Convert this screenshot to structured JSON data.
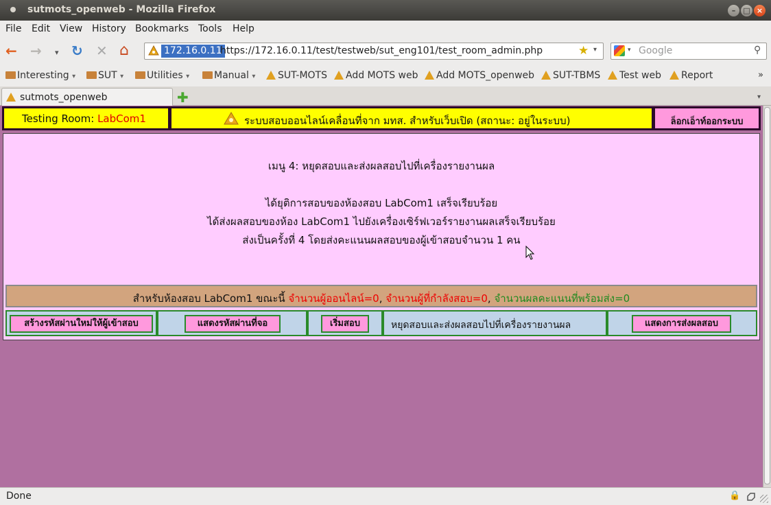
{
  "window": {
    "title": "sutmots_openweb - Mozilla Firefox",
    "min_glyph": "–",
    "max_glyph": "□",
    "close_glyph": "×"
  },
  "menu": [
    "File",
    "Edit",
    "View",
    "History",
    "Bookmarks",
    "Tools",
    "Help"
  ],
  "nav": {
    "back_icon": "←",
    "forward_icon": "→",
    "history_dropdown": "▾",
    "reload_icon": "↻",
    "stop_icon": "✕",
    "home_icon": "⌂"
  },
  "urlbar": {
    "host": "172.16.0.11",
    "url": "https://172.16.0.11/test/testweb/sut_eng101/test_room_admin.php",
    "star": "★",
    "dropdown": "▾"
  },
  "search": {
    "placeholder": "Google",
    "engine_dropdown": "▾",
    "search_icon": "⚲"
  },
  "bookmarks": [
    {
      "label": "Interesting",
      "kind": "folder",
      "arrow": "▾"
    },
    {
      "label": "SUT",
      "kind": "folder",
      "arrow": "▾"
    },
    {
      "label": "Utilities",
      "kind": "folder",
      "arrow": "▾"
    },
    {
      "label": "Manual",
      "kind": "folder",
      "arrow": "▾"
    },
    {
      "label": "SUT-MOTS",
      "kind": "link"
    },
    {
      "label": "Add MOTS web",
      "kind": "link"
    },
    {
      "label": "Add MOTS_openweb",
      "kind": "link"
    },
    {
      "label": "SUT-TBMS",
      "kind": "link"
    },
    {
      "label": "Test web",
      "kind": "link"
    },
    {
      "label": "Report",
      "kind": "link"
    }
  ],
  "bookmarks_overflow": "»",
  "tabs": [
    {
      "label": "sutmots_openweb"
    }
  ],
  "new_tab": "✚",
  "tab_list": "▾",
  "page": {
    "header": {
      "room_label": "Testing  Room:",
      "room_name": "LabCom1",
      "system_title": "ระบบสอบออนไลน์เคลื่อนที่จาก มทส. สำหรับเว็บเปิด (สถานะ: อยู่ในระบบ)",
      "logout": "ล็อกเอ็าท์ออกระบบ"
    },
    "messages": {
      "menu_title": "เมนู 4:  หยุดสอบและส่งผลสอบไปที่เครื่องรายงานผล",
      "line1": "ได้ยุติการสอบของห้องสอบ  LabCom1  เสร็จเรียบร้อย",
      "line2": "ได้ส่งผลสอบของห้อง  LabCom1  ไปยังเครื่องเซิร์ฟเวอร์รายงานผลเสร็จเรียบร้อย",
      "line3": "ส่งเป็นครั้งที่  4  โดยส่งคะแนนผลสอบของผู้เข้าสอบจำนวน  1  คน"
    },
    "status": {
      "prefix": "สำหรับห้องสอบ  LabCom1  ขณะนี้",
      "online": "จำนวนผู้ออนไลน์=0",
      "testing": "จำนวนผู้ที่กำลังสอบ=0",
      "ready": "จำนวนผลคะแนนที่พร้อมส่ง=0",
      "sep": ","
    },
    "actions": {
      "create_password": "สร้างรหัสผ่านใหม่ให้ผู้เข้าสอบ",
      "show_password": "แสดงรหัสผ่านที่จอ",
      "start": "เริ่มสอบ",
      "stop_send": "หยุดสอบและส่งผลสอบไปที่เครื่องรายงานผล",
      "show_send": "แสดงการส่งผลสอบ"
    }
  },
  "statusbar": {
    "text": "Done",
    "lock_icon": "🔒"
  },
  "colors": {
    "page_bg": "#b070a0",
    "panel_bg": "#ffccff",
    "header_yellow": "#ffff00",
    "button_pink": "#ff99dd",
    "status_tan": "#d2a47e",
    "button_row_blue": "#c0d4e8"
  }
}
